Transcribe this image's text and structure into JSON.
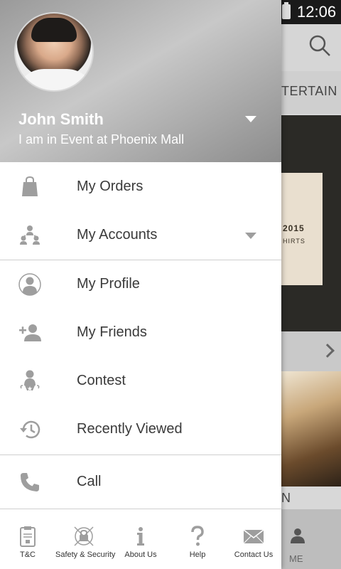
{
  "status_bar": {
    "time": "12:06"
  },
  "background": {
    "tab_label": "TERTAIN",
    "poster_year": "2015",
    "poster_sub": "HIRTS",
    "photo_label": "N",
    "me_label": "ME"
  },
  "header": {
    "user_name": "John Smith",
    "user_status": "I am in Event at Phoenix Mall"
  },
  "menu": {
    "my_orders": "My Orders",
    "my_accounts": "My Accounts",
    "my_profile": "My Profile",
    "my_friends": "My Friends",
    "contest": "Contest",
    "recently_viewed": "Recently Viewed",
    "call": "Call"
  },
  "footer": {
    "tnc": "T&C",
    "safety": "Safety & Security",
    "about": "About Us",
    "help": "Help",
    "contact": "Contact Us"
  },
  "colors": {
    "icon_gray": "#9e9e9e",
    "text_dark": "#3a3a3a",
    "divider": "#cfcfcf"
  }
}
